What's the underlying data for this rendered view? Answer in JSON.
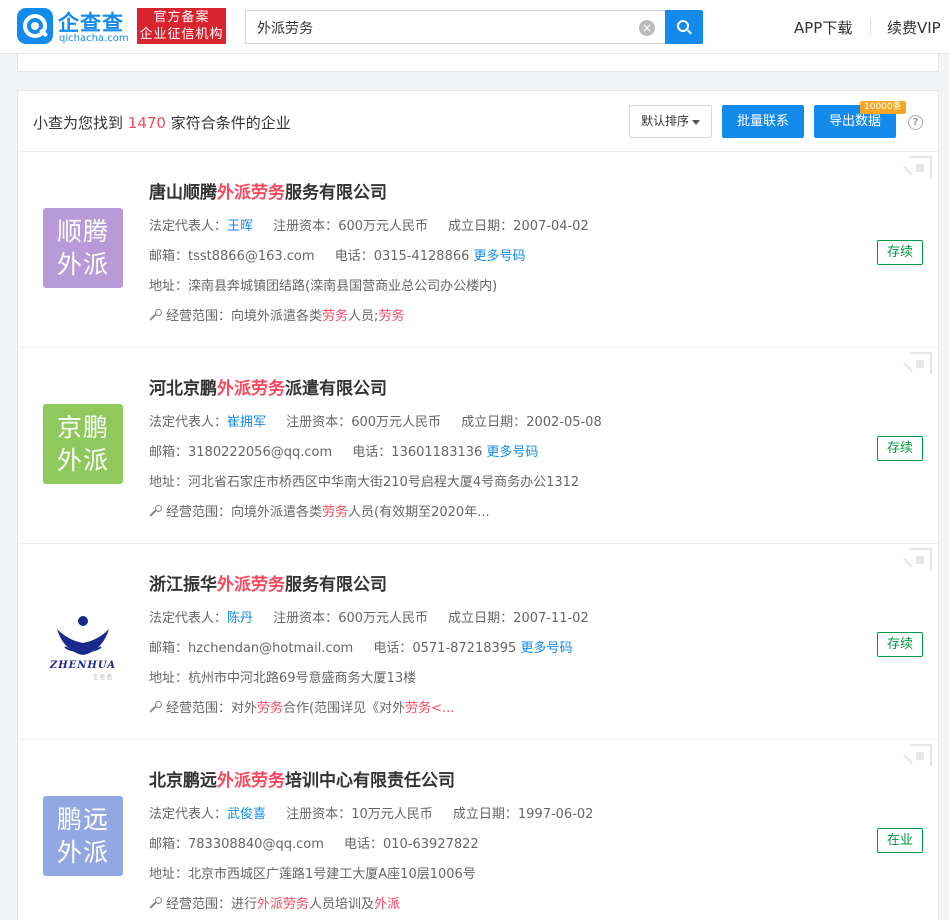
{
  "brand": {
    "name": "企查查",
    "domain": "qichacha.com",
    "badge_line1": "官方备案",
    "badge_line2": "企业征信机构"
  },
  "search": {
    "query": "外派劳务",
    "clear_glyph": "×"
  },
  "nav": {
    "app_download": "APP下载",
    "renew_vip": "续费VIP"
  },
  "summary": {
    "prefix": "小查为您找到",
    "count": "1470",
    "suffix": "家符合条件的企业"
  },
  "toolbar": {
    "sort_label": "默认排序",
    "contact_label": "批量联系",
    "export_label": "导出数据",
    "export_limit": "10000条",
    "help": "?"
  },
  "labels": {
    "legal_rep": "法定代表人：",
    "reg_capital": "注册资本：",
    "found_date": "成立日期：",
    "email": "邮箱：",
    "phone": "电话：",
    "more_phone": "更多号码",
    "address": "地址：",
    "scope": "经营范围："
  },
  "companies": [
    {
      "name_pre": "唐山顺腾",
      "name_hl": "外派劳务",
      "name_post": "服务有限公司",
      "logo_line1": "顺腾",
      "logo_line2": "外派",
      "logo_color": "#b99ad8",
      "legal_rep": "王晖",
      "reg_capital": "600万元人民币",
      "found_date": "2007-04-02",
      "email": "tsst8866@163.com",
      "phone": "0315-4128866",
      "address": "滦南县奔城镇团结路(滦南县国营商业总公司办公楼内)",
      "scope_pre": "向境外派遣各类",
      "scope_hl1": "劳务",
      "scope_mid": "人员;",
      "scope_hl2": "劳务",
      "scope_post": "",
      "status": "存续"
    },
    {
      "name_pre": "河北京鹏",
      "name_hl": "外派劳务",
      "name_post": "派遣有限公司",
      "logo_line1": "京鹏",
      "logo_line2": "外派",
      "logo_color": "#8fc95e",
      "legal_rep": "崔拥军",
      "reg_capital": "600万元人民币",
      "found_date": "2002-05-08",
      "email": "3180222056@qq.com",
      "phone": "13601183136",
      "address": "河北省石家庄市桥西区中华南大街210号启程大厦4号商务办公1312",
      "scope_pre": "向境外派遣各类",
      "scope_hl1": "劳务",
      "scope_mid": "人员(有效期至2020年...",
      "scope_hl2": "",
      "scope_post": "",
      "status": "存续"
    },
    {
      "name_pre": "浙江振华",
      "name_hl": "外派劳务",
      "name_post": "服务有限公司",
      "logo_text": "ZHENHUA",
      "logo_stamp": "企查查",
      "legal_rep": "陈丹",
      "reg_capital": "600万元人民币",
      "found_date": "2007-11-02",
      "email": "hzchendan@hotmail.com",
      "phone": "0571-87218395",
      "address": "杭州市中河北路69号意盛商务大厦13楼",
      "scope_pre": "对外",
      "scope_hl1": "劳务",
      "scope_mid": "合作(范围详见《对外",
      "scope_hl2": "劳务",
      "scope_post": "<...",
      "status": "存续"
    },
    {
      "name_pre": "北京鹏远",
      "name_hl": "外派劳务",
      "name_post": "培训中心有限责任公司",
      "logo_line1": "鹏远",
      "logo_line2": "外派",
      "logo_color": "#93a8e3",
      "legal_rep": "武俊喜",
      "reg_capital": "10万元人民币",
      "found_date": "1997-06-02",
      "email": "783308840@qq.com",
      "phone": "010-63927822",
      "address": "北京市西城区广莲路1号建工大厦A座10层1006号",
      "scope_pre": "进行",
      "scope_hl1": "外派劳务",
      "scope_mid": "人员培训及",
      "scope_hl2": "外派",
      "scope_post": "",
      "status": "在业"
    }
  ]
}
